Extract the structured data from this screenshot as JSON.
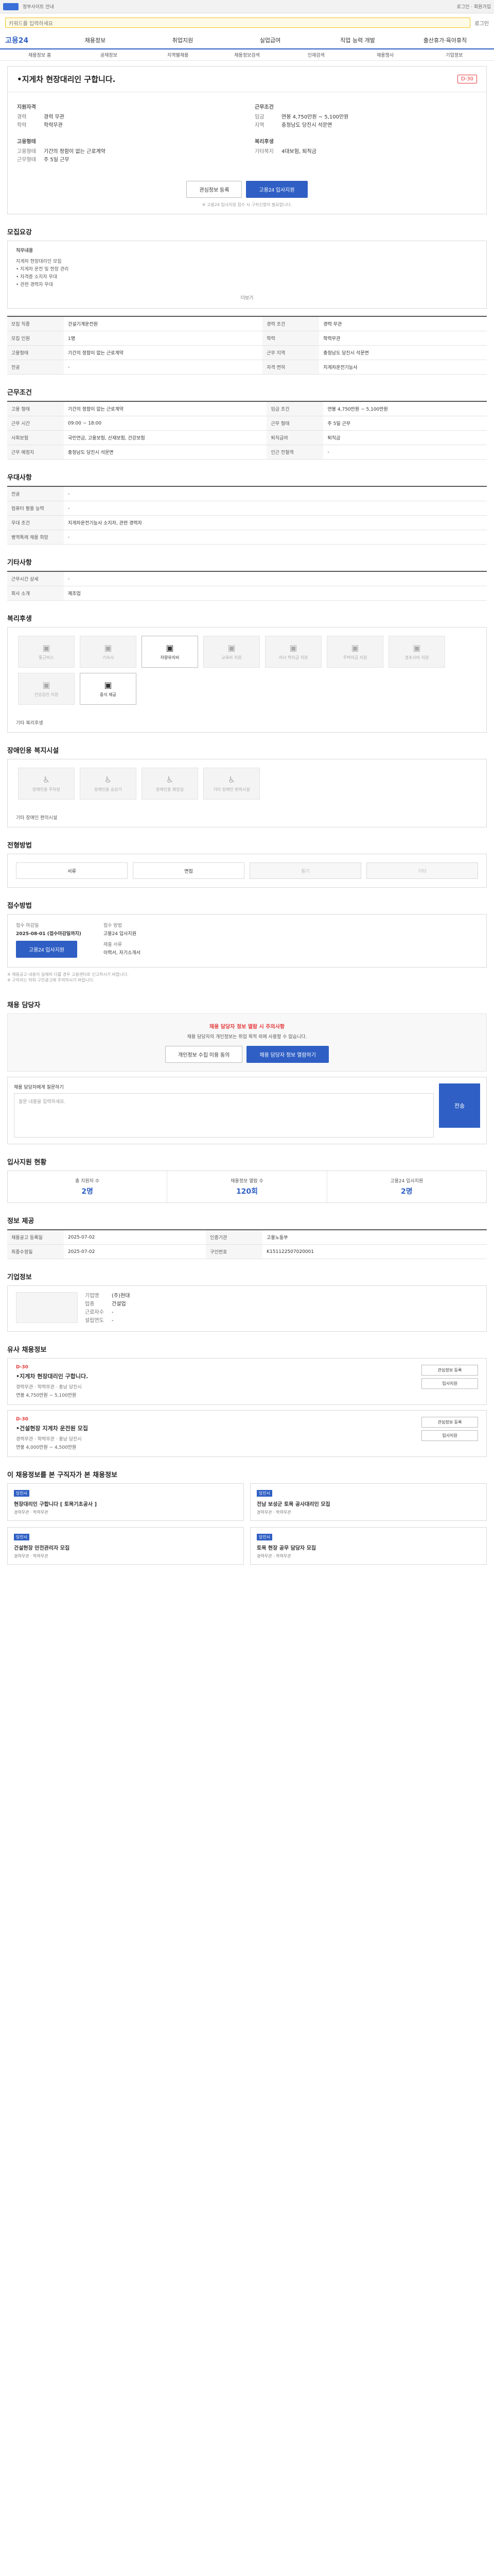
{
  "topbar": {
    "left": "정부사이트 안내",
    "right": "로그인 · 회원가입"
  },
  "search": {
    "placeholder": "키워드를 입력하세요",
    "login": "로그인"
  },
  "nav": {
    "brand": "고용24",
    "items": [
      "채용정보",
      "취업지원",
      "실업급여",
      "직업 능력 개발",
      "출산휴가·육아휴직"
    ]
  },
  "subnav": [
    "채용정보 홈",
    "공채정보",
    "지역별채용",
    "채용정보검색",
    "인재검색",
    "채용행사",
    "기업정보"
  ],
  "job": {
    "title": "•지게차 현장대리인 구합니다.",
    "dday": "D-30",
    "left_group": "지원자격",
    "left_kv": [
      [
        "경력",
        "경력 무관"
      ],
      [
        "학력",
        "학력무관"
      ]
    ],
    "left_group2": "고용형태",
    "left_kv2": [
      [
        "고용형태",
        "기간의 정함이 없는 근로계약"
      ],
      [
        "근무형태",
        "주 5일 근무"
      ]
    ],
    "right_group": "근무조건",
    "right_kv": [
      [
        "임금",
        "연봉 4,750만원 ~ 5,100만원"
      ],
      [
        "지역",
        "충청남도 당진시 석문면"
      ]
    ],
    "right_group2": "복리후생",
    "right_kv2": [
      [
        "기타복지",
        "4대보험, 퇴직금"
      ]
    ],
    "btn_save": "관심정보 등록",
    "btn_apply": "고용24 입사지원",
    "note": "※ 고용24 입사지원 접수 시 구직신청이 필요합니다."
  },
  "sections": {
    "summary": "모집요강",
    "detail": "근무조건",
    "apply_req": "우대사항",
    "etc": "기타사항",
    "welfare": "복리후생",
    "disabled": "장애인용 복지시설",
    "method": "전형방법",
    "apply": "접수방법",
    "contact": "채용 담당자",
    "stats": "입사지원 현황",
    "info": "정보 제공",
    "company": "기업정보",
    "similar": "유사 채용정보",
    "recommend": "이 채용정보를 본 구직자가 본 채용정보"
  },
  "summary_box": {
    "title": "직무내용",
    "lines": [
      "지게차 현장대리인 모집",
      "• 지게차 운전 및 현장 관리",
      "• 자격증 소지자 우대",
      "• 관련 경력자 우대"
    ],
    "more": "더보기"
  },
  "summary_table": [
    [
      "모집 직종",
      "건설기계운전원",
      "경력 조건",
      "경력 무관"
    ],
    [
      "모집 인원",
      "1명",
      "학력",
      "학력무관"
    ],
    [
      "고용형태",
      "기간의 정함이 없는 근로계약",
      "근무 지역",
      "충청남도 당진시 석문면"
    ],
    [
      "전공",
      "-",
      "자격 면허",
      "지게차운전기능사"
    ]
  ],
  "detail_table": [
    [
      "고용 형태",
      "기간의 정함이 없는 근로계약",
      "임금 조건",
      "연봉 4,750만원 ~ 5,100만원"
    ],
    [
      "근무 시간",
      "09:00 ~ 18:00",
      "근무 형태",
      "주 5일 근무"
    ],
    [
      "사회보험",
      "국민연금, 고용보험, 산재보험, 건강보험",
      "퇴직급여",
      "퇴직금"
    ],
    [
      "근무 예정지",
      "충청남도 당진시 석문면",
      "인근 전철역",
      "-"
    ]
  ],
  "pref_table": [
    [
      "전공",
      "-"
    ],
    [
      "컴퓨터 활용 능력",
      "-"
    ],
    [
      "우대 조건",
      "지게차운전기능사 소지자, 관련 경력자"
    ],
    [
      "병역특례 채용 희망",
      "-"
    ]
  ],
  "etc_table": [
    [
      "근무시간 상세",
      "-"
    ],
    [
      "회사 소개",
      "제조업"
    ]
  ],
  "welfare_items": [
    "통근버스",
    "기숙사",
    "차량유지비",
    "교육비 지원",
    "자녀 학자금 지원",
    "주택자금 지원",
    "경조사비 지원",
    "건강검진 지원",
    "중식 제공"
  ],
  "welfare_on": [
    2,
    8
  ],
  "welfare_foot": "기타 복리후생",
  "disabled_items": [
    "장애인용 주차장",
    "장애인용 승강기",
    "장애인용 화장실",
    "기타 장애인 편의시설"
  ],
  "disabled_foot": "기타 장애인 편의시설",
  "method_items": [
    "서류",
    "면접",
    "필기",
    "기타"
  ],
  "method_on": [
    0,
    1
  ],
  "apply_box": {
    "deadline_label": "접수 마감일",
    "deadline": "2025-08-01 (접수마감일까지)",
    "method_label": "접수 방법",
    "method": "고용24 입사지원",
    "docs_label": "제출 서류",
    "docs": "이력서, 자기소개서",
    "btn": "고용24 입사지원",
    "notes": [
      "※ 채용공고 내용이 실제와 다를 경우 고용센터로 신고하시기 바랍니다.",
      "※ 구직자는 허위 구인광고에 주의하시기 바랍니다."
    ]
  },
  "contact_alert": {
    "title": "채용 담당자 정보 열람 시 주의사항",
    "text": "채용 담당자의 개인정보는 취업 목적 외에 사용할 수 없습니다.",
    "btn1": "개인정보 수집 이용 동의",
    "btn2": "채용 담당자 정보 열람하기"
  },
  "question": {
    "title": "채용 담당자에게 질문하기",
    "placeholder": "질문 내용을 입력하세요.",
    "btn": "전송"
  },
  "stats_items": [
    {
      "label": "총 지원자 수",
      "value": "2명"
    },
    {
      "label": "채용정보 열람 수",
      "value": "120회"
    },
    {
      "label": "고용24 입사지원",
      "value": "2명"
    }
  ],
  "info_table": [
    [
      "채용공고 등록일",
      "2025-07-02",
      "인증기관",
      "고용노동부"
    ],
    [
      "최종수정일",
      "2025-07-02",
      "구인번호",
      "K151122507020001"
    ]
  ],
  "company": {
    "title": "기업정보",
    "kv": [
      [
        "기업명",
        "(주)현대"
      ],
      [
        "업종",
        "건설업"
      ],
      [
        "근로자수",
        "-"
      ],
      [
        "설립연도",
        "-"
      ]
    ]
  },
  "similar_items": [
    {
      "dday": "D-30",
      "title": "•지게차 현장대리인 구합니다.",
      "meta": "경력무관 · 학력무관 · 충남 당진시",
      "pay": "연봉 4,750만원 ~ 5,100만원"
    },
    {
      "dday": "D-30",
      "title": "•건설현장 지게차 운전원 모집",
      "meta": "경력무관 · 학력무관 · 충남 당진시",
      "pay": "연봉 4,000만원 ~ 4,500만원"
    }
  ],
  "similar_btns": [
    "관심정보 등록",
    "입사지원"
  ],
  "recommend_items": [
    {
      "tag": "당진시",
      "title": "현장대리인 구합니다 [ 토목기초공사 ]",
      "sub": "경력무관 · 학력무관"
    },
    {
      "tag": "당진시",
      "title": "전남 보성군 토목 공사대리인 모집",
      "sub": "경력무관 · 학력무관"
    },
    {
      "tag": "당진시",
      "title": "건설현장 안전관리자 모집",
      "sub": "경력무관 · 학력무관"
    },
    {
      "tag": "당진시",
      "title": "토목 현장 공무 담당자 모집",
      "sub": "경력무관 · 학력무관"
    }
  ]
}
